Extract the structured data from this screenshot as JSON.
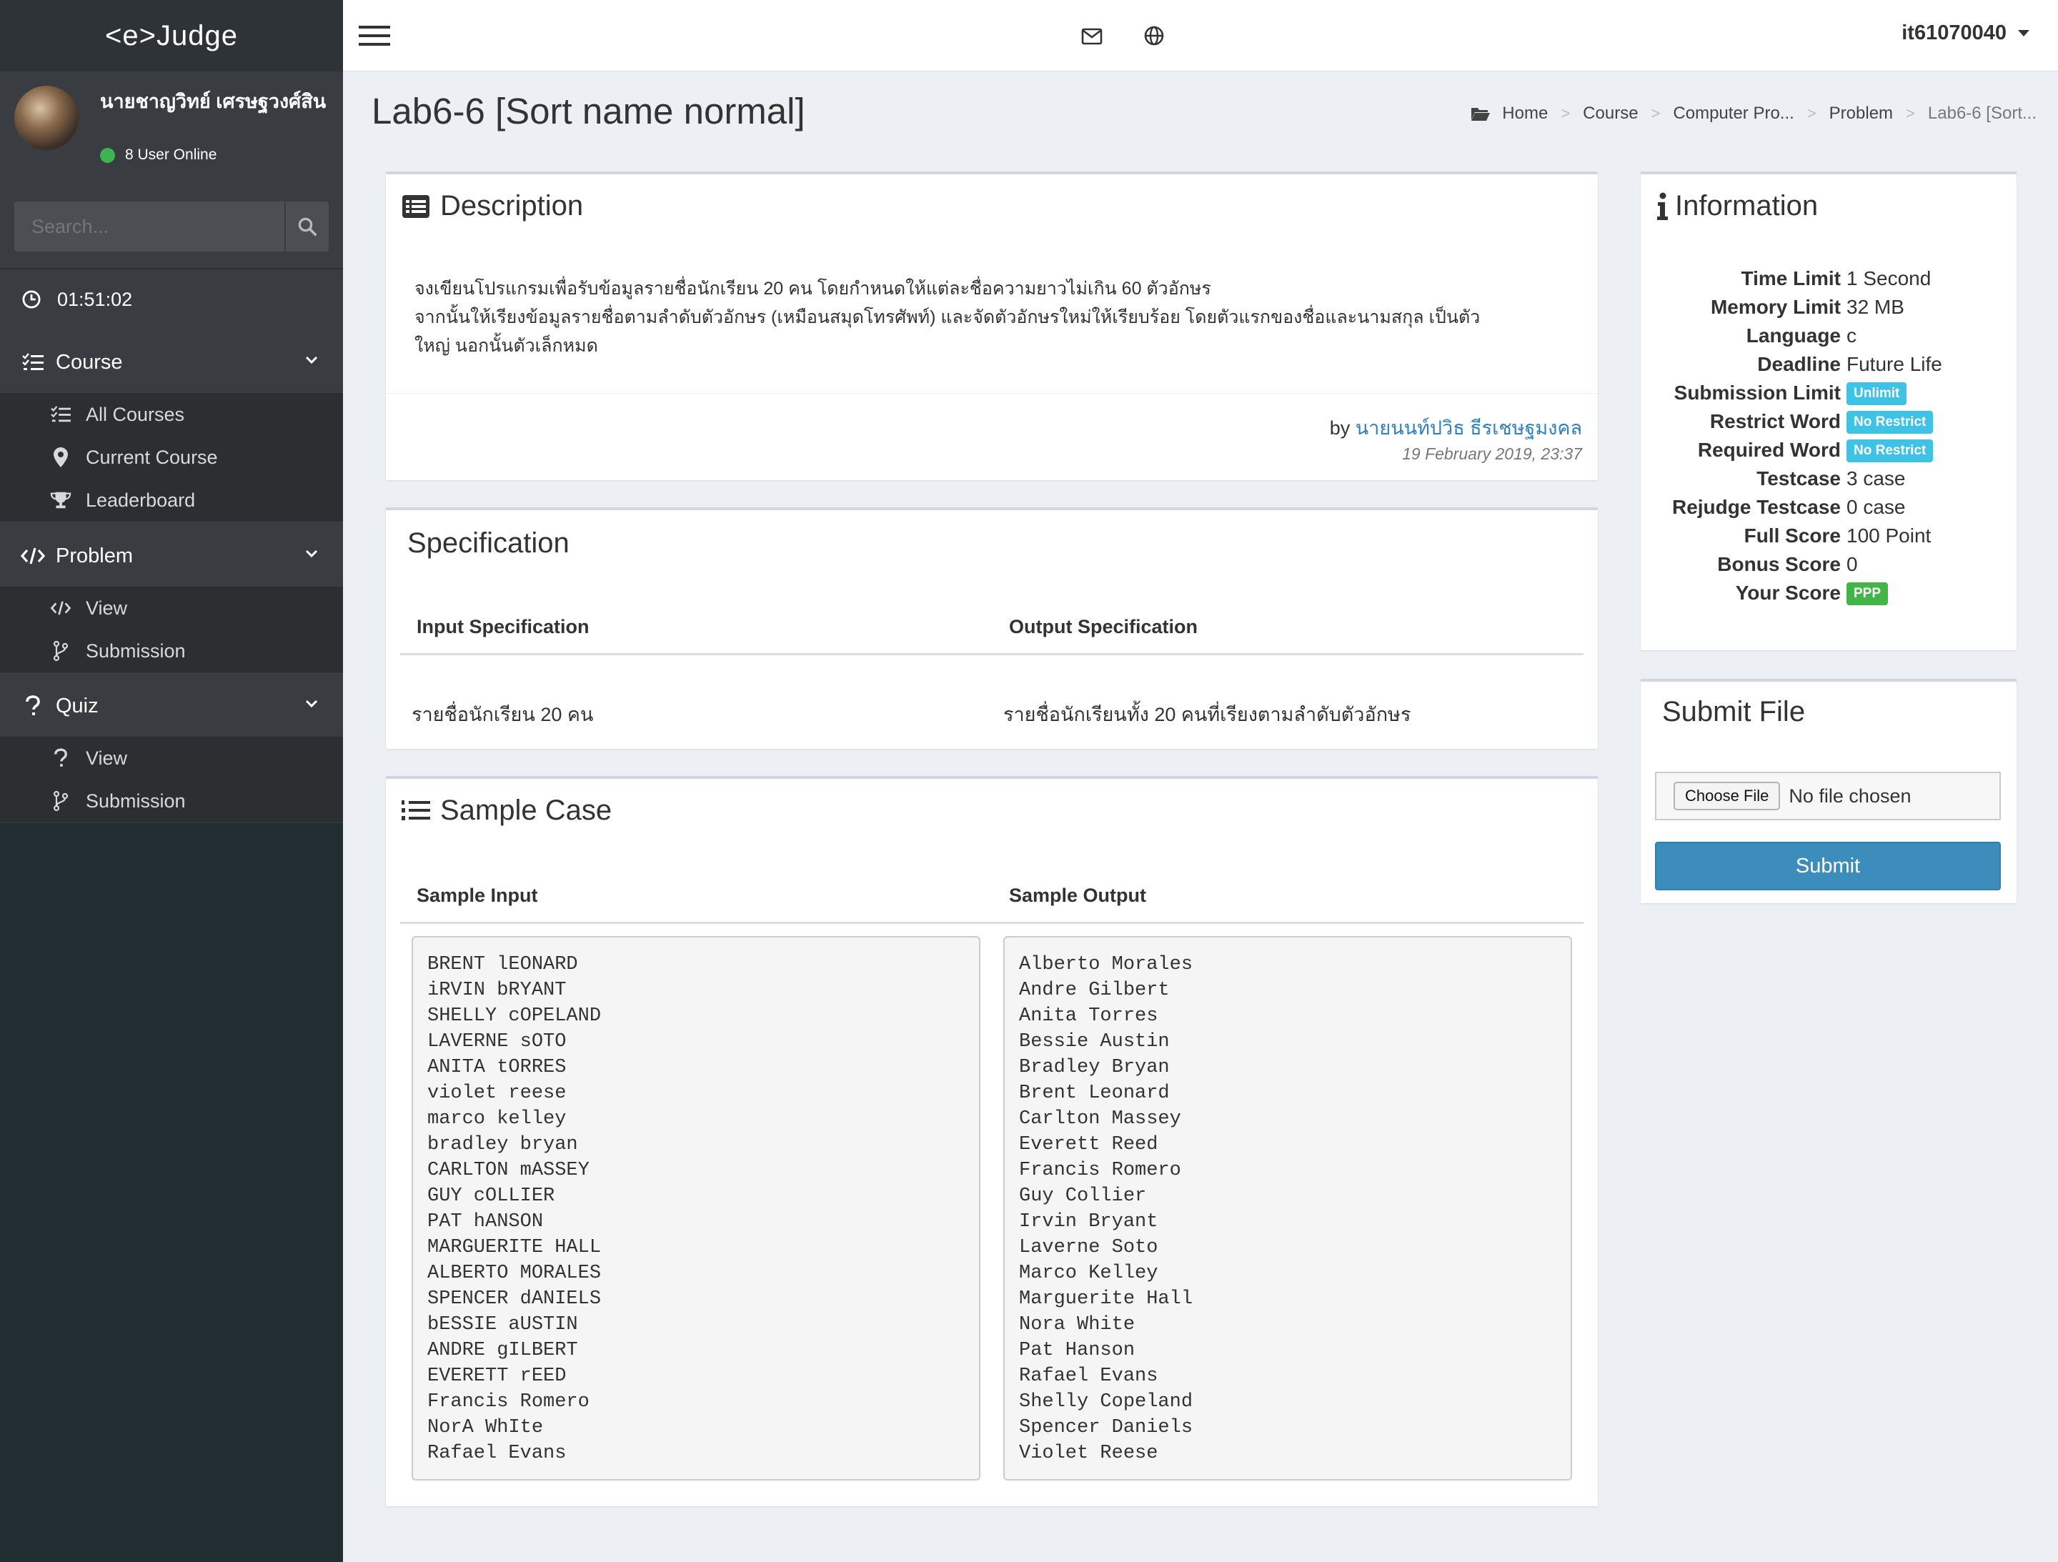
{
  "app": {
    "logo": "<e>Judge"
  },
  "user": {
    "name": "นายชาญวิทย์ เศรษฐวงศ์สิน",
    "status": "8 User Online",
    "account": "it61070040"
  },
  "search": {
    "placeholder": "Search..."
  },
  "clock": {
    "time": "01:51:02"
  },
  "sidebar": {
    "course": {
      "label": "Course",
      "items": [
        "All Courses",
        "Current Course",
        "Leaderboard"
      ]
    },
    "problem": {
      "label": "Problem",
      "items": [
        "View",
        "Submission"
      ]
    },
    "quiz": {
      "label": "Quiz",
      "items": [
        "View",
        "Submission"
      ]
    }
  },
  "page": {
    "title": "Lab6-6 [Sort name normal]"
  },
  "breadcrumb": [
    "Home",
    "Course",
    "Computer Pro...",
    "Problem",
    "Lab6-6 [Sort..."
  ],
  "description": {
    "heading": "Description",
    "lines": [
      "จงเขียนโปรแกรมเพื่อรับข้อมูลรายชื่อนักเรียน 20 คน โดยกำหนดให้แต่ละชื่อความยาวไม่เกิน 60 ตัวอักษร",
      "จากนั้นให้เรียงข้อมูลรายชื่อตามลำดับตัวอักษร (เหมือนสมุดโทรศัพท์) และจัดตัวอักษรใหม่ให้เรียบร้อย โดยตัวแรกของชื่อและนามสกุล เป็นตัว",
      "ใหญ่ นอกนั้นตัวเล็กหมด"
    ],
    "by_prefix": "by",
    "author": "นายนนท์ปวิธ ธีรเชษฐมงคล",
    "timestamp": "19 February 2019, 23:37"
  },
  "specification": {
    "heading": "Specification",
    "input_header": "Input Specification",
    "output_header": "Output Specification",
    "input_text": "รายชื่อนักเรียน 20 คน",
    "output_text": "รายชื่อนักเรียนทั้ง 20 คนที่เรียงตามลำดับตัวอักษร"
  },
  "sample": {
    "heading": "Sample Case",
    "input_header": "Sample Input",
    "output_header": "Sample Output",
    "input": "BRENT lEONARD\niRVIN bRYANT\nSHELLY cOPELAND\nLAVERNE sOTO\nANITA tORRES\nviolet reese\nmarco kelley\nbradley bryan\nCARLTON mASSEY\nGUY cOLLIER\nPAT hANSON\nMARGUERITE HALL\nALBERTO MORALES\nSPENCER dANIELS\nbESSIE aUSTIN\nANDRE gILBERT\nEVERETT rEED\nFrancis Romero\nNorA WhIte\nRafael Evans",
    "output": "Alberto Morales\nAndre Gilbert\nAnita Torres\nBessie Austin\nBradley Bryan\nBrent Leonard\nCarlton Massey\nEverett Reed\nFrancis Romero\nGuy Collier\nIrvin Bryant\nLaverne Soto\nMarco Kelley\nMarguerite Hall\nNora White\nPat Hanson\nRafael Evans\nShelly Copeland\nSpencer Daniels\nViolet Reese"
  },
  "information": {
    "heading": "Information",
    "rows": [
      {
        "label": "Time Limit",
        "value": "1 Second"
      },
      {
        "label": "Memory Limit",
        "value": "32 MB"
      },
      {
        "label": "Language",
        "value": "c"
      },
      {
        "label": "Deadline",
        "value": "Future Life"
      },
      {
        "label": "Submission Limit",
        "value": "Unlimit"
      },
      {
        "label": "Restrict Word",
        "value": "No Restrict"
      },
      {
        "label": "Required Word",
        "value": "No Restrict"
      },
      {
        "label": "Testcase",
        "value": "3 case"
      },
      {
        "label": "Rejudge Testcase",
        "value": "0 case"
      },
      {
        "label": "Full Score",
        "value": "100 Point"
      },
      {
        "label": "Bonus Score",
        "value": "0"
      },
      {
        "label": "Your Score",
        "value": "PPP"
      }
    ]
  },
  "submit": {
    "heading": "Submit File",
    "choose_label": "Choose File",
    "file_status": "No file chosen",
    "button": "Submit"
  },
  "colors": {
    "sidebar": "#222d32",
    "primary": "#3c8dbc",
    "badge_info": "#3ec2e6",
    "badge_success": "#43b548",
    "link": "#2f80c0"
  }
}
